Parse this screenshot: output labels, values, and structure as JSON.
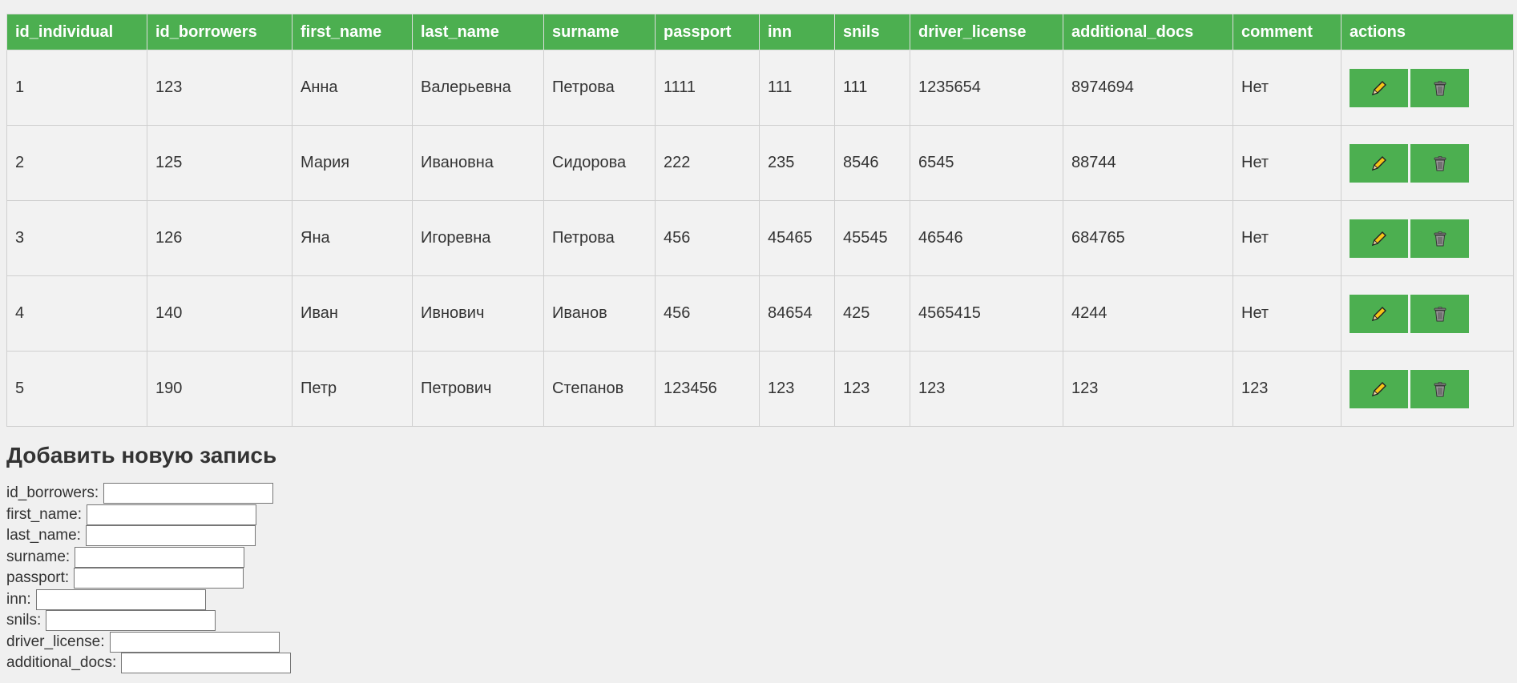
{
  "table": {
    "headers": [
      "id_individual",
      "id_borrowers",
      "first_name",
      "last_name",
      "surname",
      "passport",
      "inn",
      "snils",
      "driver_license",
      "additional_docs",
      "comment",
      "actions"
    ],
    "rows": [
      [
        "1",
        "123",
        "Анна",
        "Валерьевна",
        "Петрова",
        "1111",
        "111",
        "111",
        "1235654",
        "8974694",
        "Нет"
      ],
      [
        "2",
        "125",
        "Мария",
        "Ивановна",
        "Сидорова",
        "222",
        "235",
        "8546",
        "6545",
        "88744",
        "Нет"
      ],
      [
        "3",
        "126",
        "Яна",
        "Игоревна",
        "Петрова",
        "456",
        "45465",
        "45545",
        "46546",
        "684765",
        "Нет"
      ],
      [
        "4",
        "140",
        "Иван",
        "Ивнович",
        "Иванов",
        "456",
        "84654",
        "425",
        "4565415",
        "4244",
        "Нет"
      ],
      [
        "5",
        "190",
        "Петр",
        "Петрович",
        "Степанов",
        "123456",
        "123",
        "123",
        "123",
        "123",
        "123"
      ]
    ],
    "actions": {
      "edit_icon": "pencil-icon",
      "delete_icon": "trash-icon"
    }
  },
  "form": {
    "title": "Добавить новую запись",
    "fields": [
      {
        "label": "id_borrowers:",
        "value": ""
      },
      {
        "label": "first_name:",
        "value": ""
      },
      {
        "label": "last_name:",
        "value": ""
      },
      {
        "label": "surname:",
        "value": ""
      },
      {
        "label": "passport:",
        "value": ""
      },
      {
        "label": "inn:",
        "value": ""
      },
      {
        "label": "snils:",
        "value": ""
      },
      {
        "label": "driver_license:",
        "value": ""
      },
      {
        "label": "additional_docs:",
        "value": ""
      }
    ]
  },
  "colors": {
    "header_bg": "#4caf50",
    "button_bg": "#4caf50",
    "page_bg": "#f0f0f0"
  }
}
